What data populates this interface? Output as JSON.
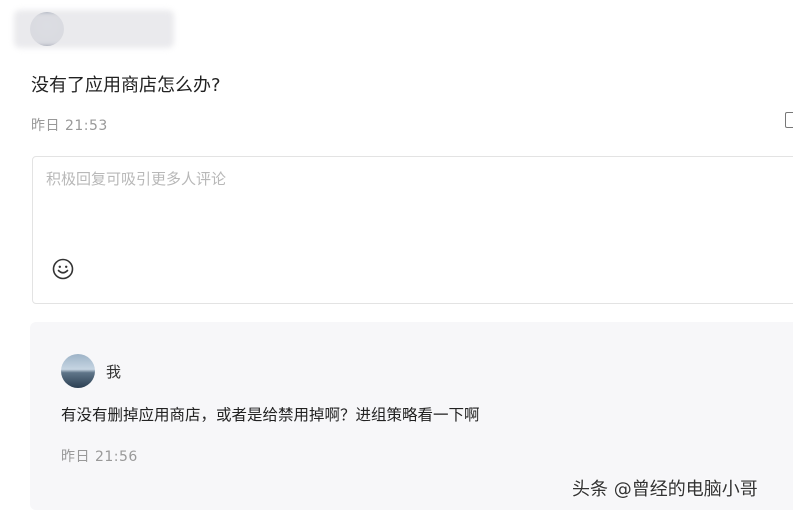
{
  "question": {
    "text": "没有了应用商店怎么办?",
    "time": "昨日 21:53"
  },
  "reply_box": {
    "placeholder": "积极回复可吸引更多人评论"
  },
  "reply": {
    "author": "我",
    "text": "有没有删掉应用商店，或者是给禁用掉啊？进组策略看一下啊",
    "time": "昨日 21:56"
  },
  "watermark": "头条 @曾经的电脑小哥"
}
